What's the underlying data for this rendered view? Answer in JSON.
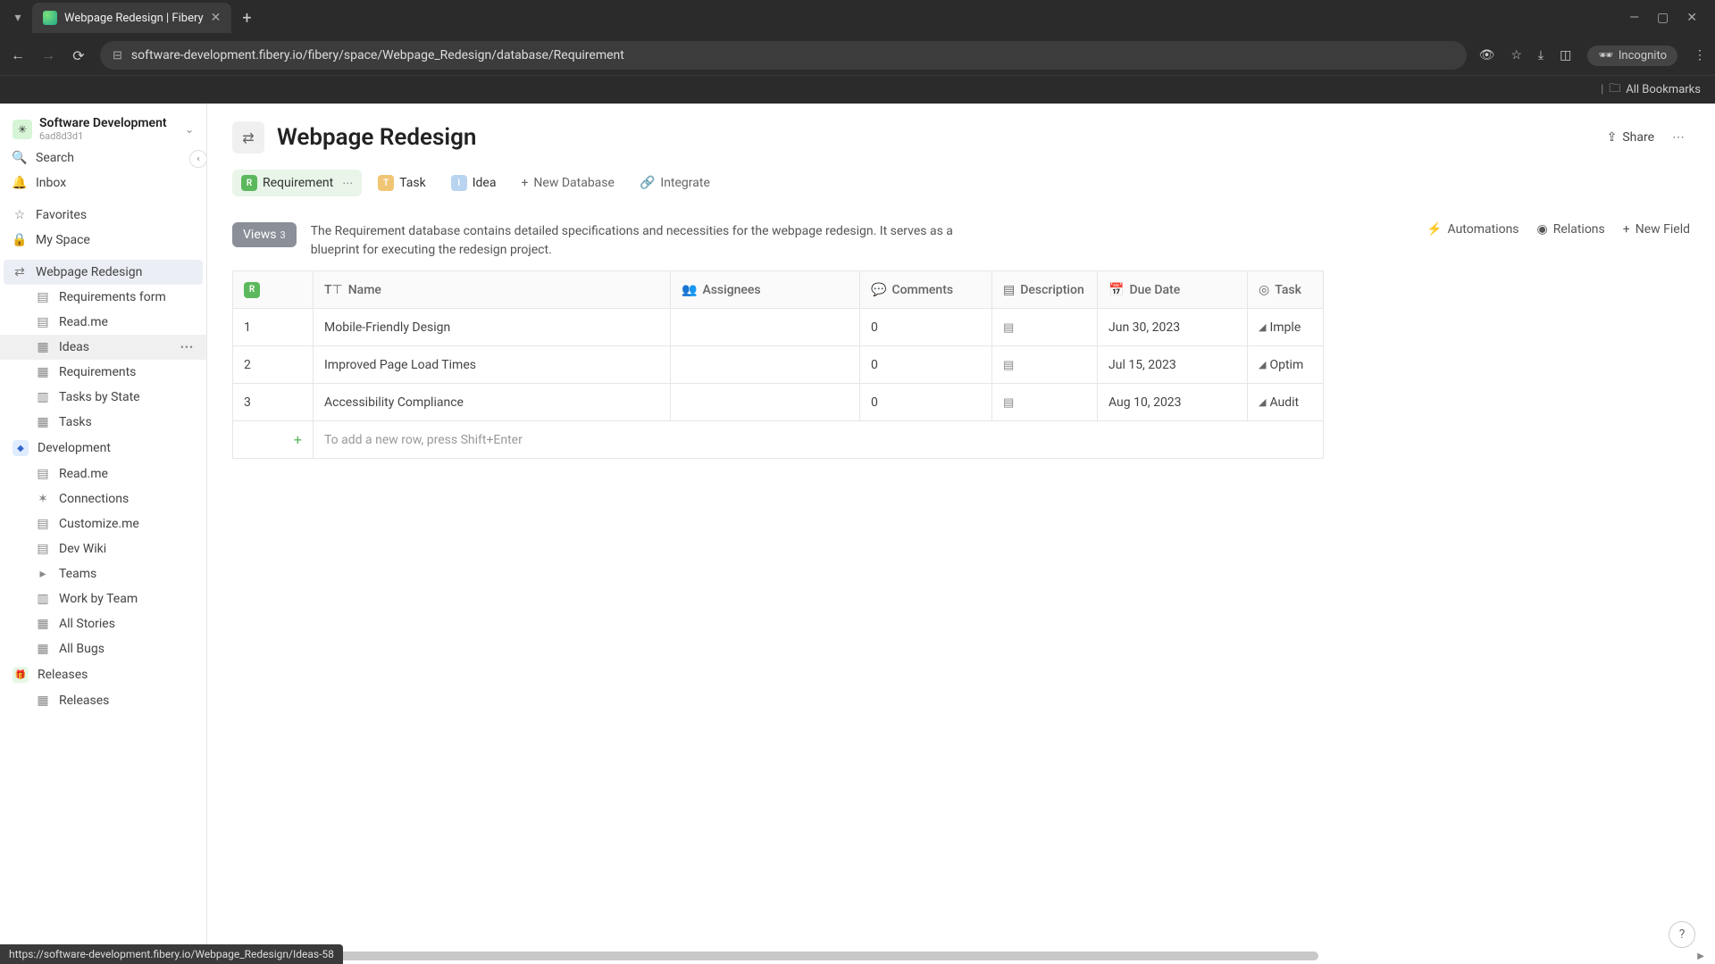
{
  "browser": {
    "tab_title": "Webpage Redesign | Fibery",
    "url": "software-development.fibery.io/fibery/space/Webpage_Redesign/database/Requirement",
    "incognito_label": "Incognito",
    "bookmarks_label": "All Bookmarks"
  },
  "workspace": {
    "name": "Software Development",
    "id": "6ad8d3d1"
  },
  "sidebar": {
    "search": "Search",
    "inbox": "Inbox",
    "favorites": "Favorites",
    "my_space": "My Space",
    "spaces": [
      {
        "name": "Webpage Redesign",
        "items": [
          "Requirements form",
          "Read.me",
          "Ideas",
          "Requirements",
          "Tasks by State",
          "Tasks"
        ],
        "active": true,
        "hovered_index": 2
      },
      {
        "name": "Development",
        "items": [
          "Read.me",
          "Connections",
          "Customize.me",
          "Dev Wiki",
          "Teams",
          "Work by Team",
          "All Stories",
          "All Bugs"
        ]
      },
      {
        "name": "Releases",
        "items": [
          "Releases"
        ]
      }
    ]
  },
  "page": {
    "title": "Webpage Redesign",
    "share": "Share"
  },
  "db_tabs": {
    "requirement": "Requirement",
    "task": "Task",
    "idea": "Idea",
    "new_db": "New Database",
    "integrate": "Integrate"
  },
  "toolbar": {
    "views_label": "Views",
    "views_count": "3",
    "description": "The Requirement database contains detailed specifications and necessities for the webpage redesign. It serves as a blueprint for executing the redesign project.",
    "automations": "Automations",
    "relations": "Relations",
    "new_field": "New Field"
  },
  "table": {
    "columns": {
      "name": "Name",
      "assignees": "Assignees",
      "comments": "Comments",
      "description": "Description",
      "due_date": "Due Date",
      "task": "Task"
    },
    "rows": [
      {
        "num": "1",
        "name": "Mobile-Friendly Design",
        "assignees": "",
        "comments": "0",
        "due": "Jun 30, 2023",
        "task": "Imple"
      },
      {
        "num": "2",
        "name": "Improved Page Load Times",
        "assignees": "",
        "comments": "0",
        "due": "Jul 15, 2023",
        "task": "Optim"
      },
      {
        "num": "3",
        "name": "Accessibility Compliance",
        "assignees": "",
        "comments": "0",
        "due": "Aug 10, 2023",
        "task": "Audit"
      }
    ],
    "add_row_hint": "To add a new row, press Shift+Enter"
  },
  "status_url": "https://software-development.fibery.io/Webpage_Redesign/Ideas-58"
}
